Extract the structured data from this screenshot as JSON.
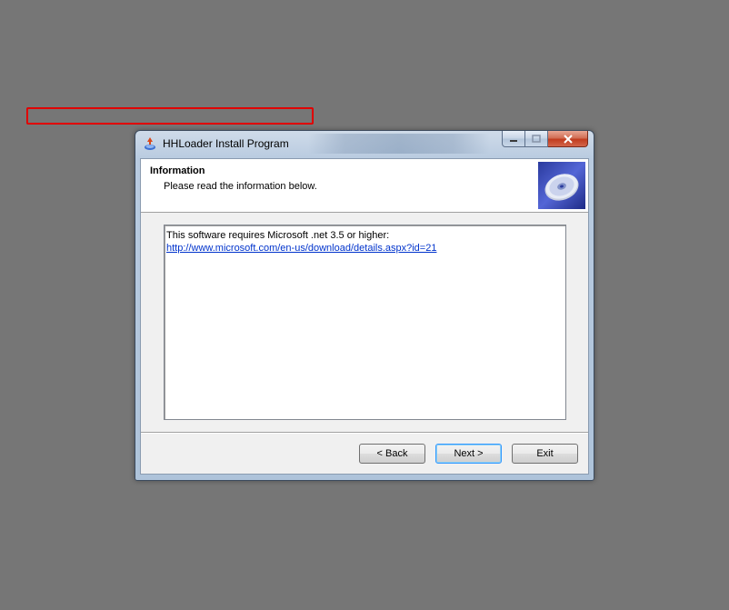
{
  "window": {
    "title": "HHLoader Install Program",
    "icon": "installer-icon"
  },
  "header": {
    "title": "Information",
    "subtitle": "Please read the information below.",
    "image": "disc-icon"
  },
  "info": {
    "text": "This software requires Microsoft .net 3.5 or higher:",
    "link": "http://www.microsoft.com/en-us/download/details.aspx?id=21"
  },
  "buttons": {
    "back": "< Back",
    "next": "Next >",
    "exit": "Exit"
  },
  "colors": {
    "highlight": "#e00000",
    "link": "#0033cc",
    "desktop": "#767676"
  }
}
